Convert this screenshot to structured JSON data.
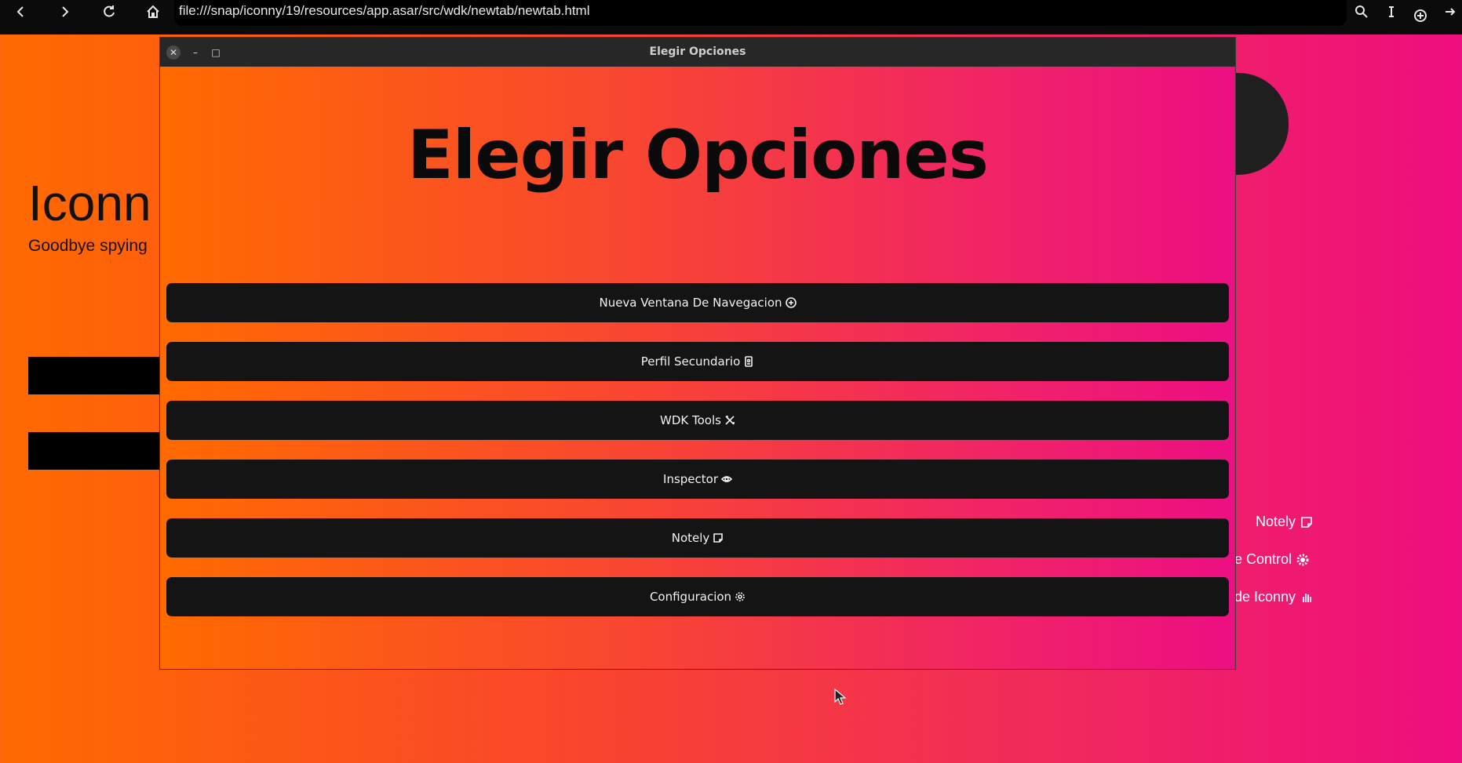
{
  "browser": {
    "url": "file:///snap/iconny/19/resources/app.asar/src/wdk/newtab/newtab.html",
    "icons": [
      "back-icon",
      "forward-icon",
      "reload-icon",
      "home-icon",
      "search-icon",
      "text-cursor-icon",
      "new-tab-icon",
      "arrow-right-icon"
    ]
  },
  "background_page": {
    "title": "Iconn",
    "subtitle": "Goodbye spying",
    "links": [
      {
        "label": "Notely",
        "icon": "note-icon"
      },
      {
        "label": "e Control",
        "icon": "gear-icon"
      },
      {
        "label": "de Iconny",
        "icon": "hand-icon"
      }
    ]
  },
  "dialog": {
    "window_title": "Elegir Opciones",
    "heading": "Elegir Opciones",
    "options": [
      {
        "label": "Nueva Ventana De Navegacion",
        "icon": "plus-circle-icon"
      },
      {
        "label": "Perfil Secundario",
        "icon": "profile-card-icon"
      },
      {
        "label": "WDK Tools",
        "icon": "tools-icon"
      },
      {
        "label": "Inspector",
        "icon": "eye-icon"
      },
      {
        "label": "Notely",
        "icon": "note-icon"
      },
      {
        "label": "Configuracion",
        "icon": "gear-icon"
      }
    ]
  },
  "colors": {
    "gradient_start": "#ff6a00",
    "gradient_end": "#ee0e7e",
    "button_bg": "#141414",
    "toolbar_bg": "#0b0b0b"
  }
}
